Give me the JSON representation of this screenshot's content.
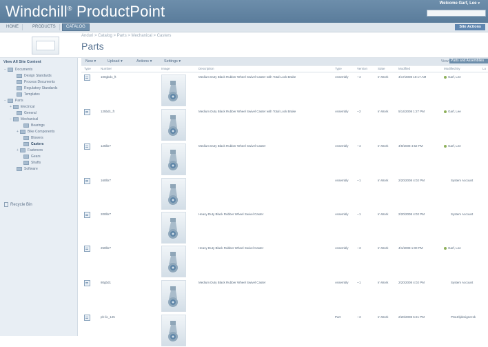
{
  "header": {
    "logo": "Windchill",
    "logo_mark": "®",
    "logo_product": "ProductPoint",
    "welcome": "Welcome Garf, Lee",
    "welcome_caret": "▾"
  },
  "nav": {
    "tabs": [
      "HOME",
      "PRODUCTS",
      "CATALOG"
    ],
    "site_actions": "Site Actions"
  },
  "breadcrumb": "Anduri > Catalog > Parts > Mechanical > Casters",
  "page_title": "Parts",
  "left_nav": {
    "view_all": "View All Site Content",
    "tree": [
      {
        "label": "Documents",
        "expander": "−"
      },
      {
        "label": "Design Standards",
        "expander": ""
      },
      {
        "label": "Process Documents",
        "expander": ""
      },
      {
        "label": "Regulatory Standards",
        "expander": ""
      },
      {
        "label": "Templates",
        "expander": ""
      },
      {
        "label": "Parts",
        "expander": "−"
      },
      {
        "label": "Electrical",
        "expander": "+"
      },
      {
        "label": "General",
        "expander": ""
      },
      {
        "label": "Mechanical",
        "expander": "−"
      },
      {
        "label": "Bearings",
        "expander": ""
      },
      {
        "label": "Bike Components",
        "expander": "+"
      },
      {
        "label": "Blowers",
        "expander": ""
      },
      {
        "label": "Casters",
        "expander": ""
      },
      {
        "label": "Fasteners",
        "expander": "+"
      },
      {
        "label": "Gears",
        "expander": ""
      },
      {
        "label": "Shafts",
        "expander": ""
      },
      {
        "label": "Software",
        "expander": ""
      }
    ],
    "recycle_bin": "Recycle Bin"
  },
  "toolbar": {
    "new": "New ▾",
    "upload": "Upload ▾",
    "actions": "Actions ▾",
    "settings": "Settings ▾",
    "view_label": "View:",
    "view_value": "Parts and Assemblies"
  },
  "columns": [
    "Type",
    "Number",
    "Image",
    "Description",
    "Type",
    "Version",
    "State",
    "Modified",
    "Modified By",
    "Lo"
  ],
  "rows": [
    {
      "number": "100gbd1_ft",
      "description": "Medium Duty Black Rubber Wheel Swivel Caster with Total Lock Brake",
      "type": "Assembly",
      "version": "--4",
      "state": "In Work",
      "modified": "4/17/2008 10:17 AM",
      "modified_by": "Garf, Lee",
      "person": true
    },
    {
      "number": "125bd1_ft",
      "description": "Medium Duty Black Rubber Wheel Swivel Caster with Total Lock Brake",
      "type": "Assembly",
      "version": "--2",
      "state": "In Work",
      "modified": "5/14/2008 1:27 PM",
      "modified_by": "Garf, Lee",
      "person": true
    },
    {
      "number": "125lbr7",
      "description": "Medium Duty Black Rubber Wheel Swivel Caster",
      "type": "Assembly",
      "version": "--4",
      "state": "In Work",
      "modified": "4/9/2008 4:52 PM",
      "modified_by": "Garf, Lee",
      "person": true
    },
    {
      "number": "160lbr7",
      "description": "",
      "type": "Assembly",
      "version": "--1",
      "state": "In Work",
      "modified": "2/20/2008 4:02 PM",
      "modified_by": "System Account",
      "person": false
    },
    {
      "number": "200lbr7",
      "description": "Heavy Duty Black Rubber Wheel Swivel Caster",
      "type": "Assembly",
      "version": "--1",
      "state": "In Work",
      "modified": "2/20/2008 4:02 PM",
      "modified_by": "System Account",
      "person": false
    },
    {
      "number": "250lbr7",
      "description": "Heavy Duty Black Rubber Wheel Swivel Caster",
      "type": "Assembly",
      "version": "--3",
      "state": "In Work",
      "modified": "4/1/2008 1:00 PM",
      "modified_by": "Garf, Lee",
      "person": true
    },
    {
      "number": "80gbd1",
      "description": "Medium Duty Black Rubber Wheel Swivel Caster",
      "type": "Assembly",
      "version": "--1",
      "state": "In Work",
      "modified": "2/20/2008 4:02 PM",
      "modified_by": "System Account",
      "person": false
    },
    {
      "number": "ph-lic_125",
      "description": "",
      "type": "Part",
      "version": "--3",
      "state": "In Work",
      "modified": "2/20/2008 6:21 PM",
      "modified_by": "PSLD\\jdesigner1k",
      "person": false
    }
  ],
  "colors": {
    "header": "#6d8eab",
    "accent": "#5f86b0",
    "left_nav": "#e8eef4"
  }
}
